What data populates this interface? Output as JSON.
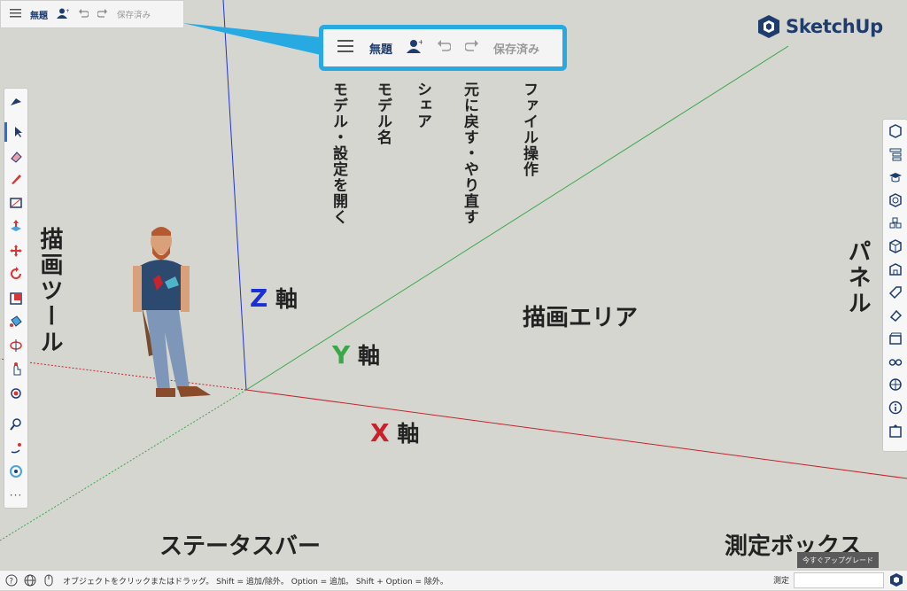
{
  "toolbar": {
    "title": "無題",
    "saved": "保存済み"
  },
  "logo": {
    "text": "SketchUp"
  },
  "annotations": {
    "file_ops": "ファイル操作",
    "undo_redo": "元に戻す・やり直す",
    "share": "シェア",
    "model_name": "モデル名",
    "open_model": "モデル・設定を開く",
    "draw_tools": "描画ツール",
    "panels": "パネル",
    "drawing_area": "描画エリア",
    "status_bar": "ステータスバー",
    "measure_box": "測定ボックス",
    "z_axis": {
      "letter": "Z",
      "text": "軸",
      "color": "#1a2fd6"
    },
    "y_axis": {
      "letter": "Y",
      "text": "軸",
      "color": "#3aa84a"
    },
    "x_axis": {
      "letter": "X",
      "text": "軸",
      "color": "#c8232c"
    }
  },
  "status": {
    "hint": "オブジェクトをクリックまたはドラッグ。 Shift = 追加/除外。 Option = 追加。 Shift + Option = 除外。",
    "measure_label": "測定",
    "upgrade": "今すぐアップグレード"
  },
  "colors": {
    "accent": "#27a9e1",
    "brand": "#1e3c6e",
    "axis_red": "#c8232c",
    "axis_green": "#3aa84a",
    "axis_blue": "#1a2fd6"
  },
  "left_tools": [
    "select-icon",
    "eraser-icon",
    "pencil-icon",
    "rectangle-icon",
    "push-pull-icon",
    "move-icon",
    "rotate-icon",
    "scale-icon",
    "paint-bucket-icon",
    "section-plane-icon",
    "orbit-icon",
    "tape-measure-icon",
    "search-icon",
    "walk-icon",
    "look-around-icon",
    "more-icon"
  ],
  "right_panels": [
    "entity-info-icon",
    "outliner-icon",
    "instructor-icon",
    "materials-icon",
    "components-icon",
    "styles-icon",
    "3d-warehouse-icon",
    "tags-icon",
    "soften-edges-icon",
    "scenes-icon",
    "display-icon",
    "shadows-icon",
    "info-icon",
    "export-icon"
  ]
}
